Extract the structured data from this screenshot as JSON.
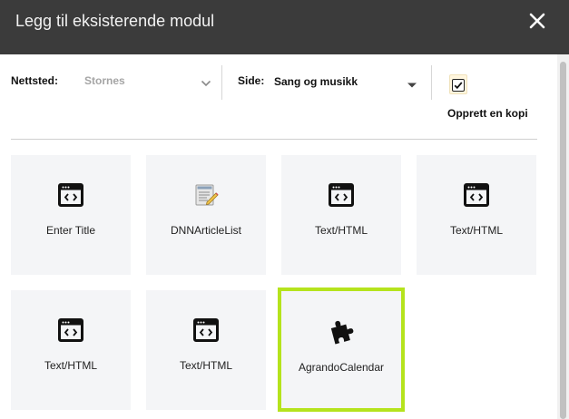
{
  "dialog": {
    "title": "Legg til eksisterende modul",
    "close_icon": "close-icon"
  },
  "toolbar": {
    "site_label": "Nettsted:",
    "site_value": "Stornes",
    "page_label": "Side:",
    "page_value": "Sang og musikk",
    "copy_label": "Opprett en kopi",
    "copy_checked": true
  },
  "modules": [
    {
      "name": "Enter Title",
      "icon": "html-module-icon"
    },
    {
      "name": "DNNArticleList",
      "icon": "article-list-icon"
    },
    {
      "name": "Text/HTML",
      "icon": "html-module-icon"
    },
    {
      "name": "Text/HTML",
      "icon": "html-module-icon"
    },
    {
      "name": "Text/HTML",
      "icon": "html-module-icon"
    },
    {
      "name": "Text/HTML",
      "icon": "html-module-icon"
    },
    {
      "name": "AgrandoCalendar",
      "icon": "puzzle-piece-icon",
      "selected": true
    }
  ],
  "colors": {
    "header_bg": "#3b3b3b",
    "tile_bg": "#f4f5f7",
    "selected_border": "#b5e31d"
  }
}
